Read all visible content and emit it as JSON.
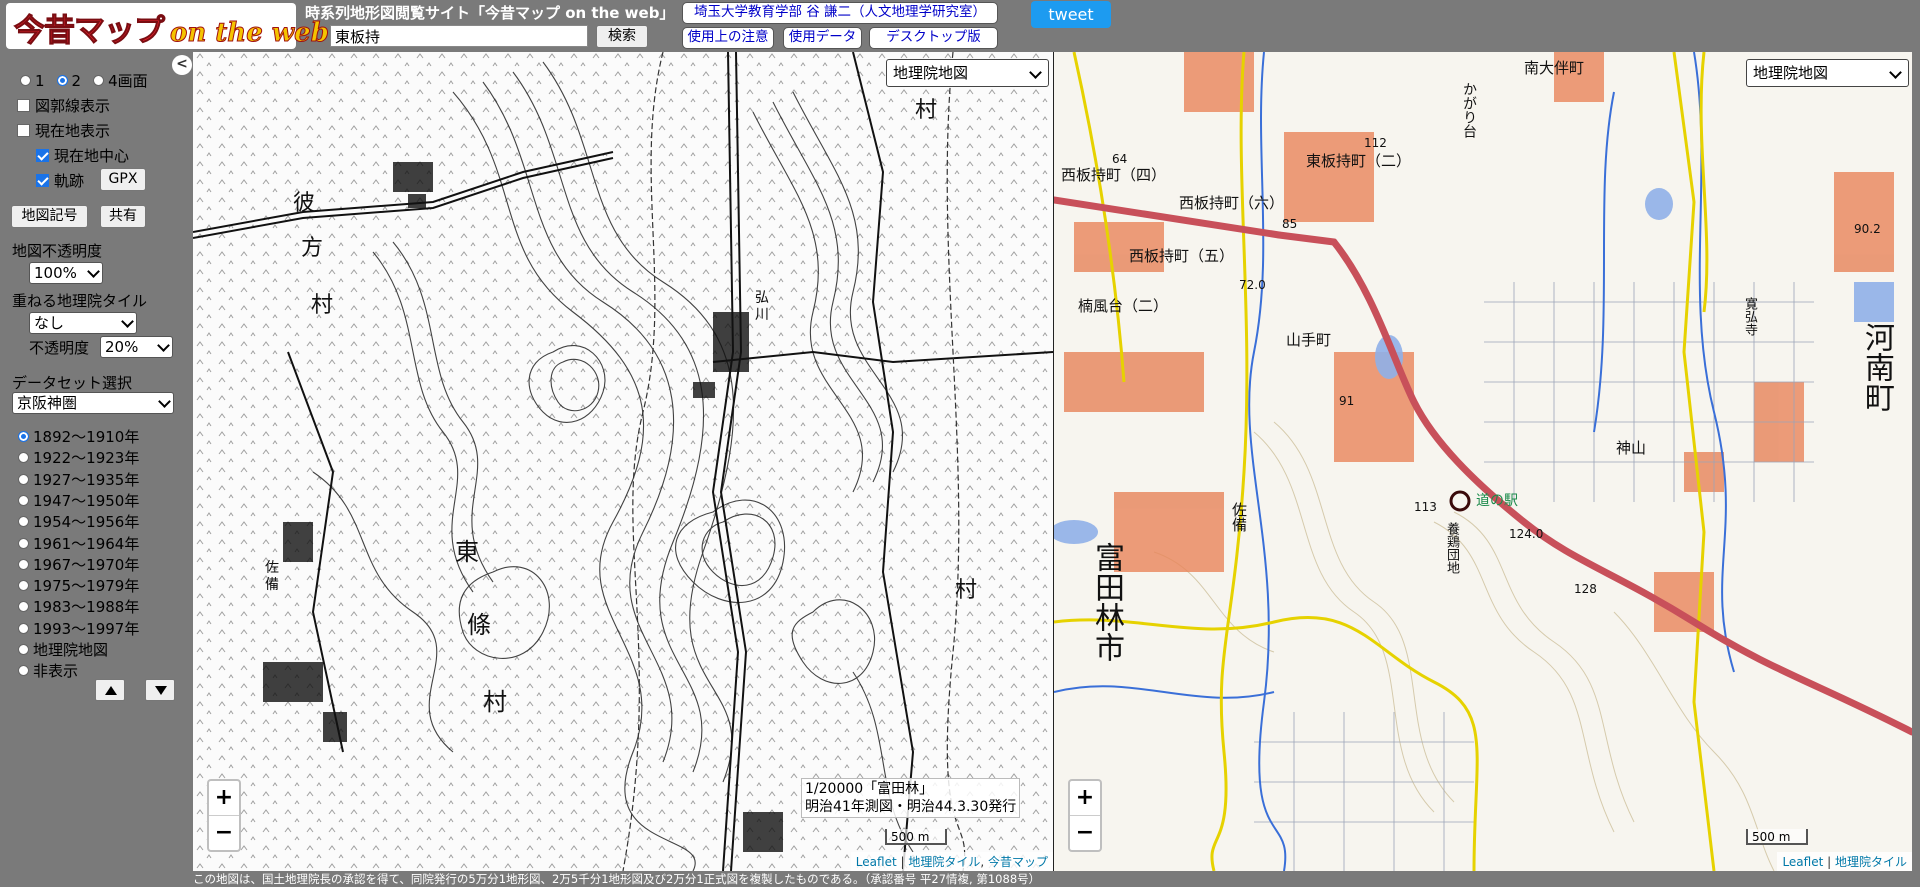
{
  "header": {
    "logo_jp": "今昔マップ",
    "logo_en": "on the web",
    "site_title": "時系列地形図閲覧サイト「今昔マップ on the web」",
    "search_value": "東板持",
    "search_button": "検索",
    "affiliation_button": "埼玉大学教育学部 谷 謙二（人文地理学研究室）",
    "notes_button": "使用上の注意",
    "data_button": "使用データ",
    "desktop_button": "デスクトップ版",
    "tweet_button": "tweet"
  },
  "sidebar": {
    "collapse": "<",
    "screen_options": [
      {
        "label": "1",
        "selected": false
      },
      {
        "label": "2",
        "selected": true
      },
      {
        "label": "4画面",
        "selected": false
      }
    ],
    "graticule_label": "図郭線表示",
    "current_location_label": "現在地表示",
    "center_current_label": "現在地中心",
    "track_label": "軌跡",
    "gpx_button": "GPX",
    "legend_button": "地図記号",
    "share_button": "共有",
    "opacity_label": "地図不透明度",
    "opacity_value": "100%",
    "overlay_label": "重ねる地理院タイル",
    "overlay_value": "なし",
    "overlay_opacity_label": "不透明度",
    "overlay_opacity_value": "20%",
    "dataset_label": "データセット選択",
    "dataset_value": "京阪神圏",
    "periods": [
      {
        "label": "1892～1910年",
        "selected": true
      },
      {
        "label": "1922～1923年",
        "selected": false
      },
      {
        "label": "1927～1935年",
        "selected": false
      },
      {
        "label": "1947～1950年",
        "selected": false
      },
      {
        "label": "1954～1956年",
        "selected": false
      },
      {
        "label": "1961～1964年",
        "selected": false
      },
      {
        "label": "1967～1970年",
        "selected": false
      },
      {
        "label": "1975～1979年",
        "selected": false
      },
      {
        "label": "1983～1988年",
        "selected": false
      },
      {
        "label": "1993～1997年",
        "selected": false
      },
      {
        "label": "地理院地図",
        "selected": false
      },
      {
        "label": "非表示",
        "selected": false
      }
    ]
  },
  "left_map": {
    "layer_select": "地理院地図",
    "caption_line1": "1/20000「富田林」",
    "caption_line2": "明治41年測図・明治44.3.30発行",
    "scale": "500 m",
    "attribution": [
      "Leaflet",
      "地理院タイル",
      "今昔マップ"
    ],
    "labels": [
      "彼",
      "方",
      "村",
      "村",
      "東",
      "條",
      "村",
      "村",
      "佐",
      "備",
      "弘",
      "川"
    ]
  },
  "right_map": {
    "layer_select": "地理院地図",
    "scale": "500 m",
    "attribution": [
      "Leaflet",
      "地理院タイル"
    ],
    "labels": {
      "nishi_itamochi_4": "西板持町（四）",
      "nishi_itamochi_6": "西板持町（六）",
      "nishi_itamochi_5": "西板持町（五）",
      "higashi_itamochi_2": "東板持町（二）",
      "higashi_itamochi": "東板持町",
      "kusukaze": "楠風台（二）",
      "kusukaze_v": "楠風台",
      "yamate": "山手町",
      "minami_ohtomo": "南大伴町",
      "kagaridai": "かがり台",
      "kanan_cho": "河南町",
      "tondabayashi": "富田林市",
      "kamiyama": "神山",
      "michi_no_eki": "道の駅",
      "sabi": "佐備",
      "youkeidanchi": "養鶏団地",
      "hirokawadera": "寛弘寺",
      "elev_112": "112",
      "elev_91": "91",
      "elev_113": "113",
      "elev_124": "124.0",
      "elev_128": "128",
      "elev_85": "85",
      "elev_72": "72.0",
      "elev_64": "64",
      "elev_90": "90.2"
    }
  },
  "footnote": "この地図は、国土地理院長の承認を得て、同院発行の5万分1地形図、2万5千分1地形図及び2万分1正式図を複製したものである。（承認番号 平27情複, 第1088号）",
  "colors": {
    "background": "#7a7a7a",
    "tweet": "#1d9bf0",
    "road_red": "#c8505a",
    "road_yellow": "#e6d200",
    "water_blue": "#3a6fd8",
    "building_orange": "#e8845a"
  }
}
